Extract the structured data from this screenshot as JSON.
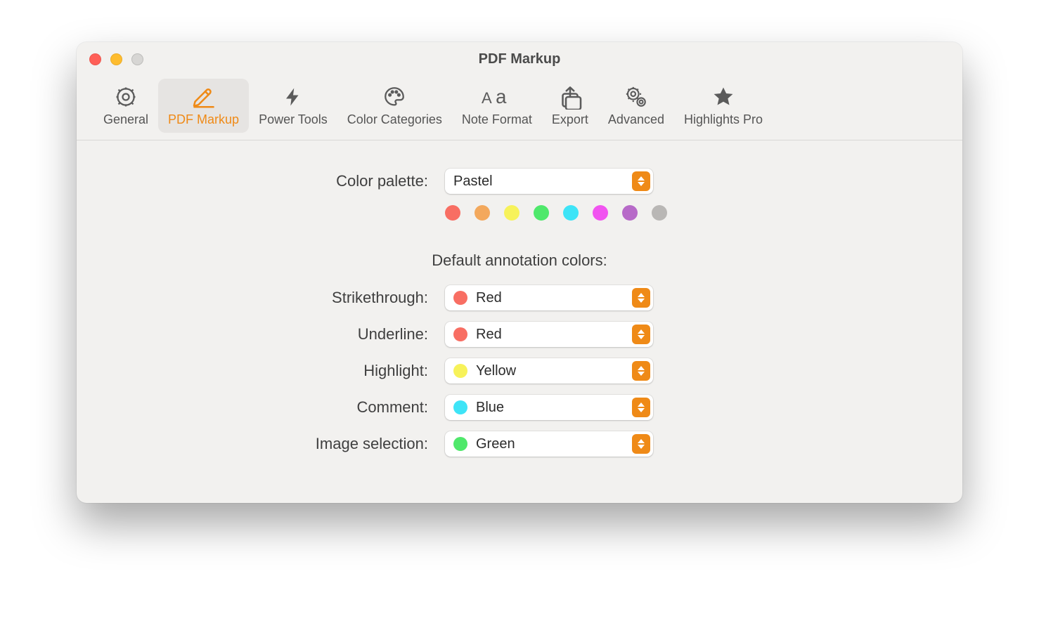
{
  "window": {
    "title": "PDF Markup"
  },
  "tabs": {
    "general": {
      "label": "General"
    },
    "pdf_markup": {
      "label": "PDF Markup"
    },
    "power_tools": {
      "label": "Power Tools"
    },
    "color_categories": {
      "label": "Color Categories"
    },
    "note_format": {
      "label": "Note Format"
    },
    "export": {
      "label": "Export"
    },
    "advanced": {
      "label": "Advanced"
    },
    "highlights_pro": {
      "label": "Highlights Pro"
    }
  },
  "accentColor": "#ef8a17",
  "palette": {
    "label": "Color palette:",
    "value": "Pastel",
    "swatches": [
      "#f86e63",
      "#f3a85c",
      "#f7f25a",
      "#4fe86b",
      "#3ee4f7",
      "#f154f0",
      "#b76ac8",
      "#b9b7b5"
    ]
  },
  "defaults": {
    "heading": "Default annotation colors:",
    "items": {
      "strikethrough": {
        "label": "Strikethrough:",
        "value": "Red",
        "color": "#f86e63"
      },
      "underline": {
        "label": "Underline:",
        "value": "Red",
        "color": "#f86e63"
      },
      "highlight": {
        "label": "Highlight:",
        "value": "Yellow",
        "color": "#f7f25a"
      },
      "comment": {
        "label": "Comment:",
        "value": "Blue",
        "color": "#3ee4f7"
      },
      "image_selection": {
        "label": "Image selection:",
        "value": "Green",
        "color": "#4fe86b"
      }
    }
  }
}
